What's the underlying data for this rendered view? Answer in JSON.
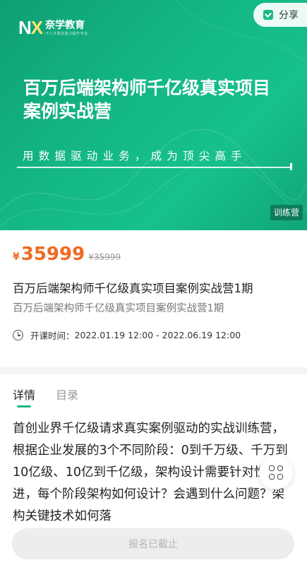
{
  "header": {
    "logo_mark": "N",
    "logo_mark_x": "X",
    "logo_name": "奈学教育",
    "logo_sub": "IT人才职业能力提升平台",
    "share_label": "分享"
  },
  "hero": {
    "title": "百万后端架构师千亿级真实项目案例实战营",
    "slogan": "用数据驱动业务，成为顶尖高手",
    "tag": "训练营"
  },
  "price": {
    "symbol": "¥",
    "current": "35999",
    "original": "¥35999"
  },
  "course": {
    "title": "百万后端架构师千亿级真实项目案例实战营1期",
    "subtitle": "百万后端架构师千亿级真实项目案例实战营1期",
    "schedule_label": "开课时间：",
    "schedule_value": "2022.01.19 12:00 - 2022.06.19 12:00"
  },
  "tabs": [
    {
      "label": "详情"
    },
    {
      "label": "目录"
    }
  ],
  "description": "首创业界千亿级请求真实案例驱动的实战训练营，根据企业发展的3个不同阶段：0到千万级、千万到10亿级、10亿到千亿级，架构设计需要针对性演进，每个阶段架构如何设计？会遇到什么问题？架构关键技术如何落",
  "footer": {
    "enroll_label": "报名已截止"
  },
  "colors": {
    "brand_green": "#19b987",
    "price_orange": "#ef6a22"
  }
}
